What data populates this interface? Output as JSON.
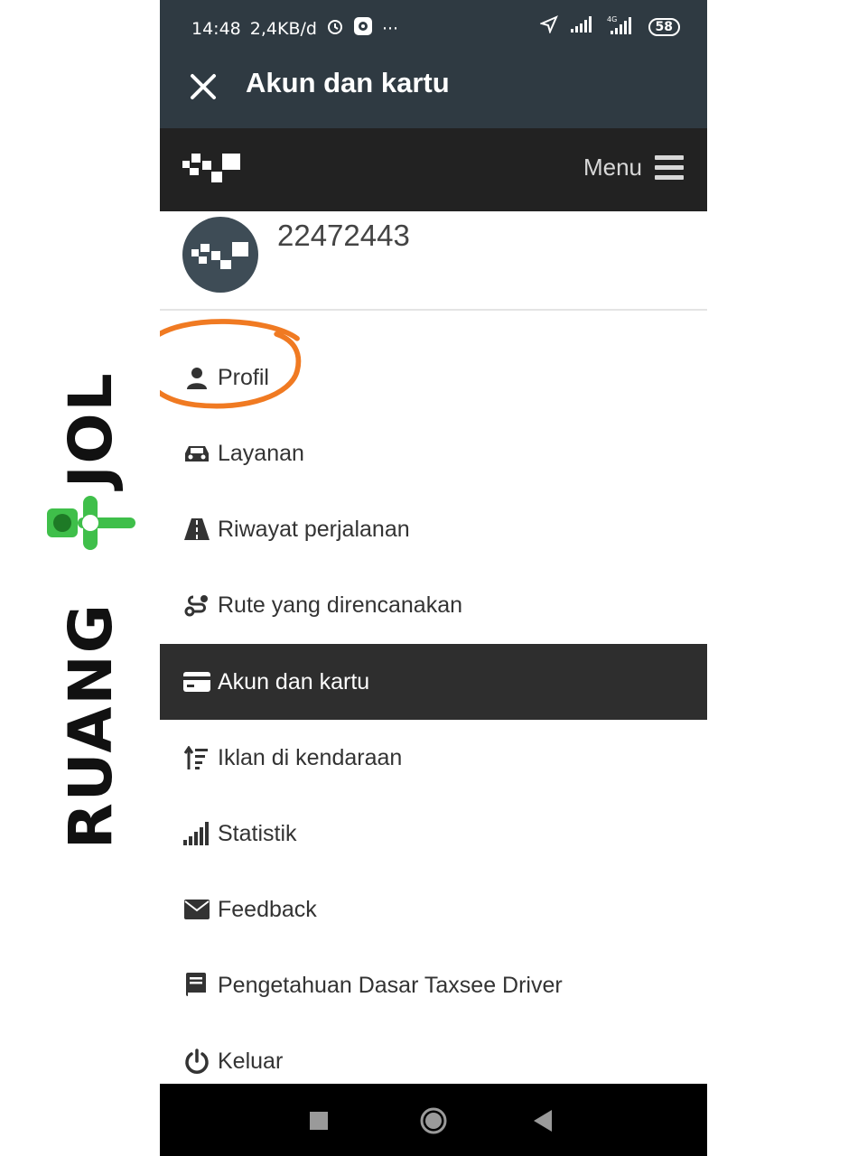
{
  "status": {
    "time": "14:48",
    "speed": "2,4KB/d",
    "more": "···",
    "battery": "58"
  },
  "title_bar": {
    "title": "Akun dan kartu"
  },
  "app_bar": {
    "menu_label": "Menu"
  },
  "profile": {
    "user_id": "22472443"
  },
  "menu": {
    "items": [
      {
        "label": "Profil",
        "icon": "user-icon"
      },
      {
        "label": "Layanan",
        "icon": "car-icon"
      },
      {
        "label": "Riwayat perjalanan",
        "icon": "road-icon"
      },
      {
        "label": "Rute yang direncanakan",
        "icon": "route-icon"
      },
      {
        "label": "Akun dan kartu",
        "icon": "card-icon",
        "active": true
      },
      {
        "label": "Iklan di kendaraan",
        "icon": "sort-icon"
      },
      {
        "label": "Statistik",
        "icon": "signal-icon"
      },
      {
        "label": "Feedback",
        "icon": "envelope-icon"
      },
      {
        "label": "Pengetahuan Dasar Taxsee Driver",
        "icon": "book-icon"
      },
      {
        "label": "Keluar",
        "icon": "power-icon"
      }
    ]
  },
  "watermark": {
    "text_left": "RUANG",
    "text_right": "JOL"
  },
  "colors": {
    "header": "#2f3a42",
    "appbar": "#222222",
    "active": "#2e2e2e",
    "highlight": "#f07a22",
    "watermark_green": "#3fbf4a"
  }
}
